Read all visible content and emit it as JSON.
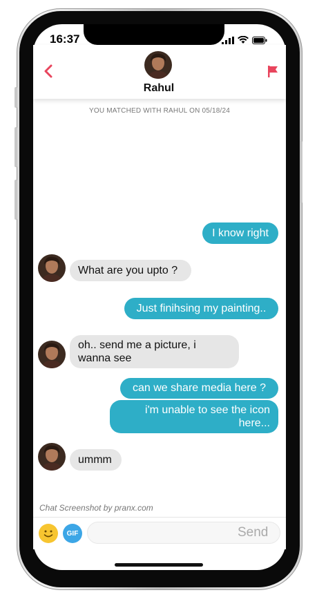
{
  "status_bar": {
    "time": "16:37"
  },
  "header": {
    "name": "Rahul"
  },
  "match_note": "YOU MATCHED WITH RAHUL ON 05/18/24",
  "messages": [
    {
      "from": "me",
      "text": "I know right"
    },
    {
      "from": "them",
      "text": "What are you upto ?"
    },
    {
      "from": "me",
      "text": "Just finihsing my painting.."
    },
    {
      "from": "them",
      "text": "oh.. send me a picture, i wanna see"
    },
    {
      "from": "me",
      "text": "can we share media here ?"
    },
    {
      "from": "me",
      "text": "i'm unable to see the icon here..."
    },
    {
      "from": "them",
      "text": "ummm"
    }
  ],
  "watermark": "Chat Screenshot by pranx.com",
  "input_bar": {
    "gif_label": "GIF",
    "send_label": "Send",
    "message_placeholder": ""
  },
  "colors": {
    "accent": "#e8455d",
    "outgoing_bubble": "#2eaec7",
    "incoming_bubble": "#e6e6e6",
    "gif_button": "#3ca6e6",
    "emoji": "#f7c530"
  },
  "icons": [
    "back-chevron-icon",
    "flag-icon",
    "signal-icon",
    "wifi-icon",
    "battery-icon",
    "emoji-icon"
  ]
}
